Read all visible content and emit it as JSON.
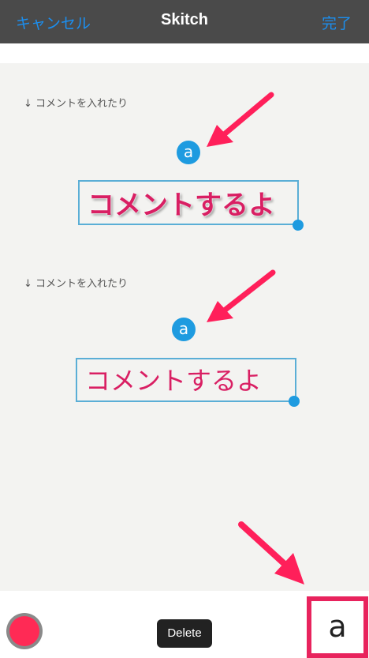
{
  "header": {
    "cancel_label": "キャンセル",
    "title": "Skitch",
    "done_label": "完了"
  },
  "canvas": {
    "annotations": [
      {
        "note": "↓ コメントを入れたり",
        "badge_letter": "a",
        "comment_text": "コメントするよ",
        "style": "bold-outlined"
      },
      {
        "note": "↓ コメントを入れたり",
        "badge_letter": "a",
        "comment_text": "コメントするよ",
        "style": "plain"
      }
    ]
  },
  "toolbar": {
    "current_color": "#ff2a55",
    "delete_label": "Delete",
    "text_tool_letter": "a"
  },
  "colors": {
    "accent": "#1b8ff0",
    "handle": "#1e9be0",
    "arrow": "#ff1f5a",
    "highlight": "#e8235d"
  }
}
